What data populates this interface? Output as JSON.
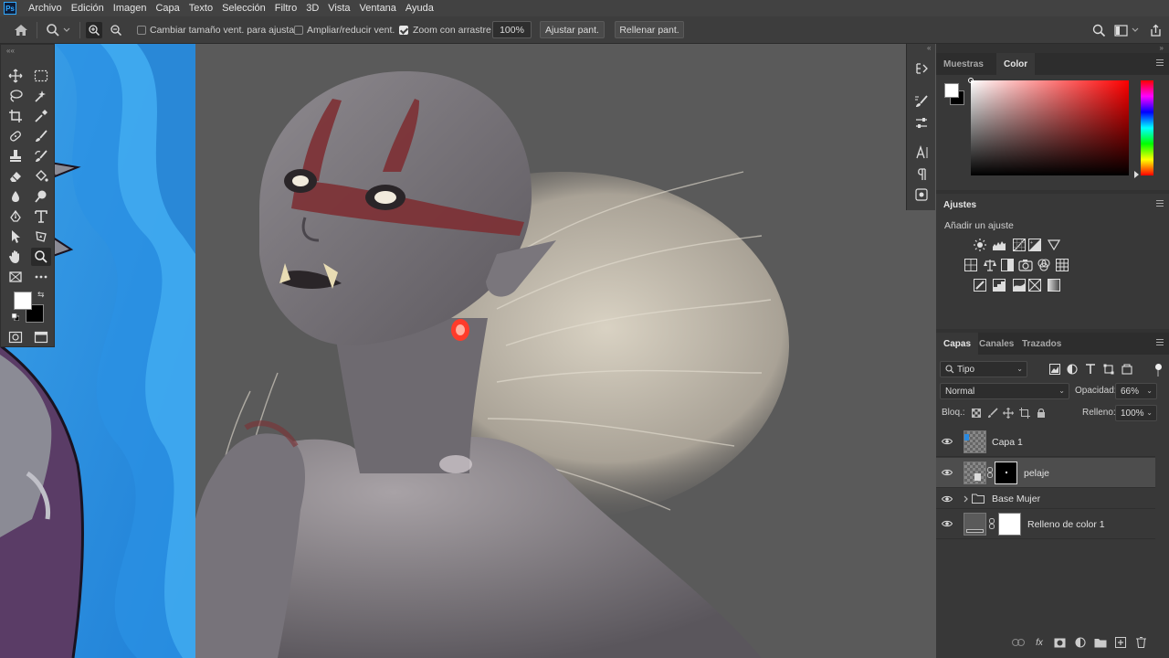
{
  "app": {
    "logo_text": "Ps"
  },
  "menu": [
    "Archivo",
    "Edición",
    "Imagen",
    "Capa",
    "Texto",
    "Selección",
    "Filtro",
    "3D",
    "Vista",
    "Ventana",
    "Ayuda"
  ],
  "options": {
    "resize_windows": "Cambiar tamaño vent. para ajustar",
    "zoom_all": "Ampliar/reducir vent.",
    "scrubby_zoom": "Zoom con arrastre",
    "zoom_value": "100%",
    "fit_screen": "Ajustar pant.",
    "fill_screen": "Rellenar pant."
  },
  "panels": {
    "color": {
      "tabs": [
        "Muestras",
        "Color"
      ],
      "active": "Color"
    },
    "adjustments": {
      "title": "Ajustes",
      "subtitle": "Añadir un ajuste"
    },
    "layers": {
      "tabs": [
        "Capas",
        "Canales",
        "Trazados"
      ],
      "filter_kind": "Tipo",
      "blend_mode": "Normal",
      "opacity_label": "Opacidad:",
      "opacity_value": "66%",
      "lock_label": "Bloq.:",
      "fill_label": "Relleno:",
      "fill_value": "100%",
      "items": [
        {
          "name": "Capa 1"
        },
        {
          "name": "pelaje"
        },
        {
          "name": "Base Mujer"
        },
        {
          "name": "Relleno de color 1"
        }
      ]
    }
  },
  "colors": {
    "accent": "#31a8ff",
    "panel_bg": "#383838",
    "canvas_bg": "#535353",
    "foreground": "#ffffff",
    "background": "#000000"
  }
}
